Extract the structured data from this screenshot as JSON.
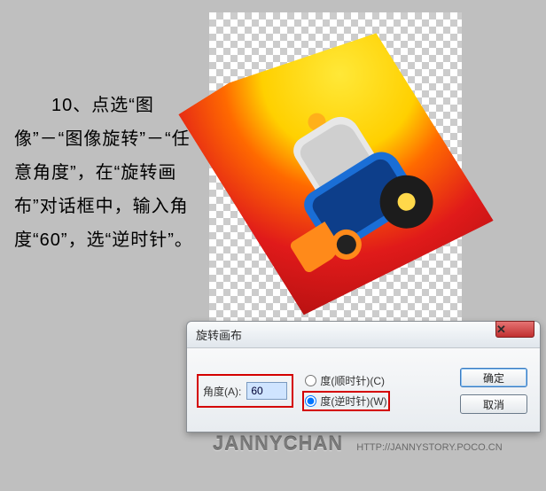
{
  "instruction": "　　10、点选“图像”－“图像旋转”－“任意角度”，在“旋转画布”对话框中，输入角度“60”，选“逆时针”。",
  "canvas": {
    "alt": "toy-tractor-photo-rotated"
  },
  "dialog": {
    "title": "旋转画布",
    "close": "✕",
    "angle_label": "角度(A):",
    "angle_value": "60",
    "radio_cw_label": "度(顺时针)(C)",
    "radio_ccw_label": "度(逆时针)(W)",
    "radio_selected": "ccw",
    "ok": "确定",
    "cancel": "取消"
  },
  "watermark": {
    "name": "JANNYCHAN",
    "url": "HTTP://JANNYSTORY.POCO.CN"
  }
}
